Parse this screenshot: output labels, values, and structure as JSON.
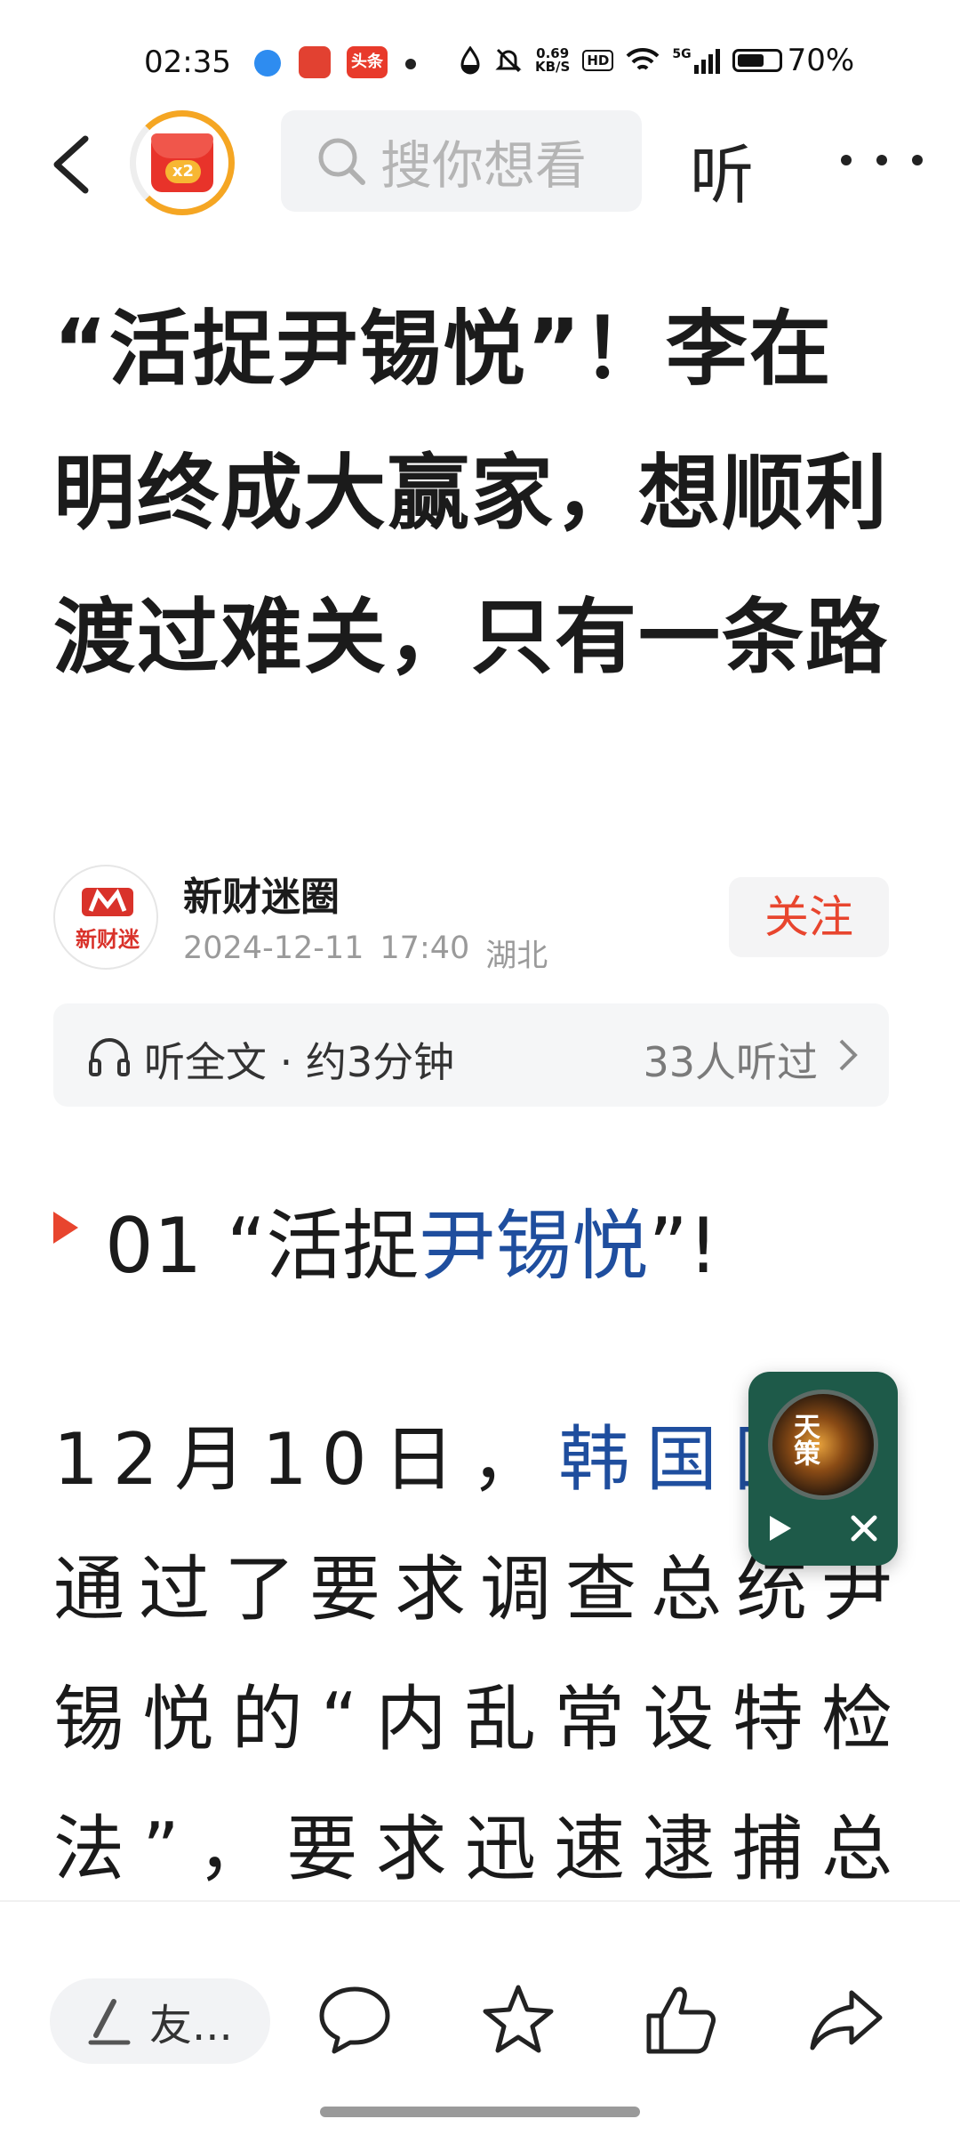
{
  "status_bar": {
    "time": "02:35",
    "net_speed_value": "0.69",
    "net_speed_unit": "KB/S",
    "hd": "HD",
    "network": "5G",
    "battery_percent": "70%",
    "battery_level": 0.7,
    "app_icons": [
      "browser-icon",
      "game-center-icon",
      "toutiao-icon"
    ],
    "toutiao_label": "头条"
  },
  "nav": {
    "search_placeholder": "搜你想看",
    "listen_label": "听",
    "reward_badge": "x2"
  },
  "article": {
    "title": "“活捉尹锡悦”！李在明终成大赢家，想顺利渡过难关，只有一条路",
    "author_name": "新财迷圈",
    "avatar_brand": "新财迷",
    "date": "2024-12-11",
    "time": "17:40",
    "location": "湖北",
    "follow_label": "关注"
  },
  "listen_bar": {
    "label": "听全文 · 约3分钟",
    "count": "33人听过"
  },
  "section": {
    "prefix": "01 “活捉",
    "link": "尹锡悦",
    "suffix": "”!"
  },
  "body": {
    "p1_date": "12月10日，",
    "p1_link": "韩国国会",
    "p1_rest": "通过了要求调查总统尹锡悦的“内乱常设特检法”，要求迅速逮捕总统"
  },
  "float_player": {
    "cover_title": "天策"
  },
  "bottom_bar": {
    "comment_placeholder": "友..."
  },
  "colors": {
    "accent_red": "#e8452e",
    "link_blue": "#1f4e9e",
    "player_green": "#1e5a49"
  }
}
